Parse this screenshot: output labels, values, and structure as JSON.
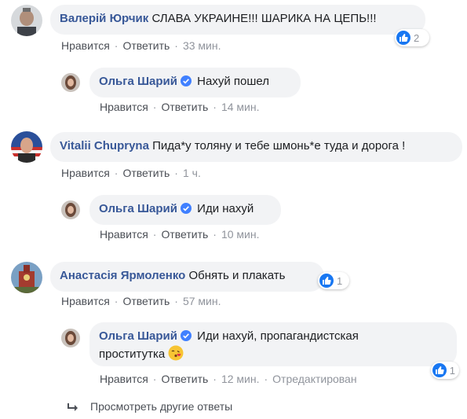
{
  "colors": {
    "author": "#385898",
    "bubble": "#f2f3f5",
    "like": "#1877f2",
    "meta": "#90949c"
  },
  "comments": [
    {
      "author": "Валерій Юрчик",
      "text": "СЛАВА УКРАИНЕ!!! ШАРИКА НА ЦЕПЬ!!!",
      "like_label": "Нравится",
      "reply_label": "Ответить",
      "time": "33 мин.",
      "reactions": "2",
      "avatar": "avatar-photo-man-gray"
    },
    {
      "author": "Ольга Шарий",
      "verified": true,
      "text": "Нахуй пошел",
      "like_label": "Нравится",
      "reply_label": "Ответить",
      "time": "14 мин.",
      "avatar": "avatar-photo-woman"
    },
    {
      "author": "Vitalii Chupryna",
      "text": "Пида*у толяну и тебе шмонь*е туда и дорога !",
      "like_label": "Нравится",
      "reply_label": "Ответить",
      "time": "1 ч.",
      "avatar": "avatar-photo-man-flag"
    },
    {
      "author": "Ольга Шарий",
      "verified": true,
      "text": "Иди нахуй",
      "like_label": "Нравится",
      "reply_label": "Ответить",
      "time": "10 мин.",
      "avatar": "avatar-photo-woman"
    },
    {
      "author": "Анастасія Ярмоленко",
      "text": "Обнять и плакать",
      "like_label": "Нравится",
      "reply_label": "Ответить",
      "time": "57 мин.",
      "reactions": "1",
      "avatar": "avatar-photo-building"
    },
    {
      "author": "Ольга Шарий",
      "verified": true,
      "text_line1": "Иди нахуй, пропагандистская",
      "text_line2": "проститутка",
      "emoji": "kissing-face-emoji",
      "like_label": "Нравится",
      "reply_label": "Ответить",
      "time": "12 мин.",
      "edited": "Отредактирован",
      "reactions": "1",
      "avatar": "avatar-photo-woman"
    }
  ],
  "more_replies": "Просмотреть другие ответы"
}
